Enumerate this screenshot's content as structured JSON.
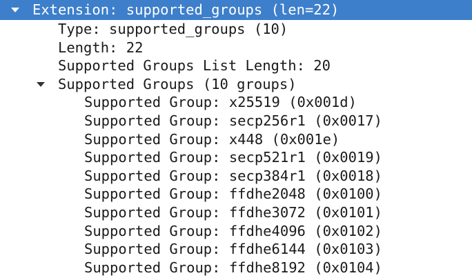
{
  "tree": {
    "extension": {
      "label": "Extension: supported_groups (len=22)",
      "expanded": true
    },
    "fields": [
      {
        "label": "Type: supported_groups (10)"
      },
      {
        "label": "Length: 22"
      },
      {
        "label": "Supported Groups List Length: 20"
      }
    ],
    "groups_node": {
      "label": "Supported Groups (10 groups)",
      "expanded": true
    },
    "groups": [
      {
        "label": "Supported Group: x25519 (0x001d)"
      },
      {
        "label": "Supported Group: secp256r1 (0x0017)"
      },
      {
        "label": "Supported Group: x448 (0x001e)"
      },
      {
        "label": "Supported Group: secp521r1 (0x0019)"
      },
      {
        "label": "Supported Group: secp384r1 (0x0018)"
      },
      {
        "label": "Supported Group: ffdhe2048 (0x0100)"
      },
      {
        "label": "Supported Group: ffdhe3072 (0x0101)"
      },
      {
        "label": "Supported Group: ffdhe4096 (0x0102)"
      },
      {
        "label": "Supported Group: ffdhe6144 (0x0103)"
      },
      {
        "label": "Supported Group: ffdhe8192 (0x0104)"
      }
    ],
    "selection_color": "#3d7fcb"
  }
}
